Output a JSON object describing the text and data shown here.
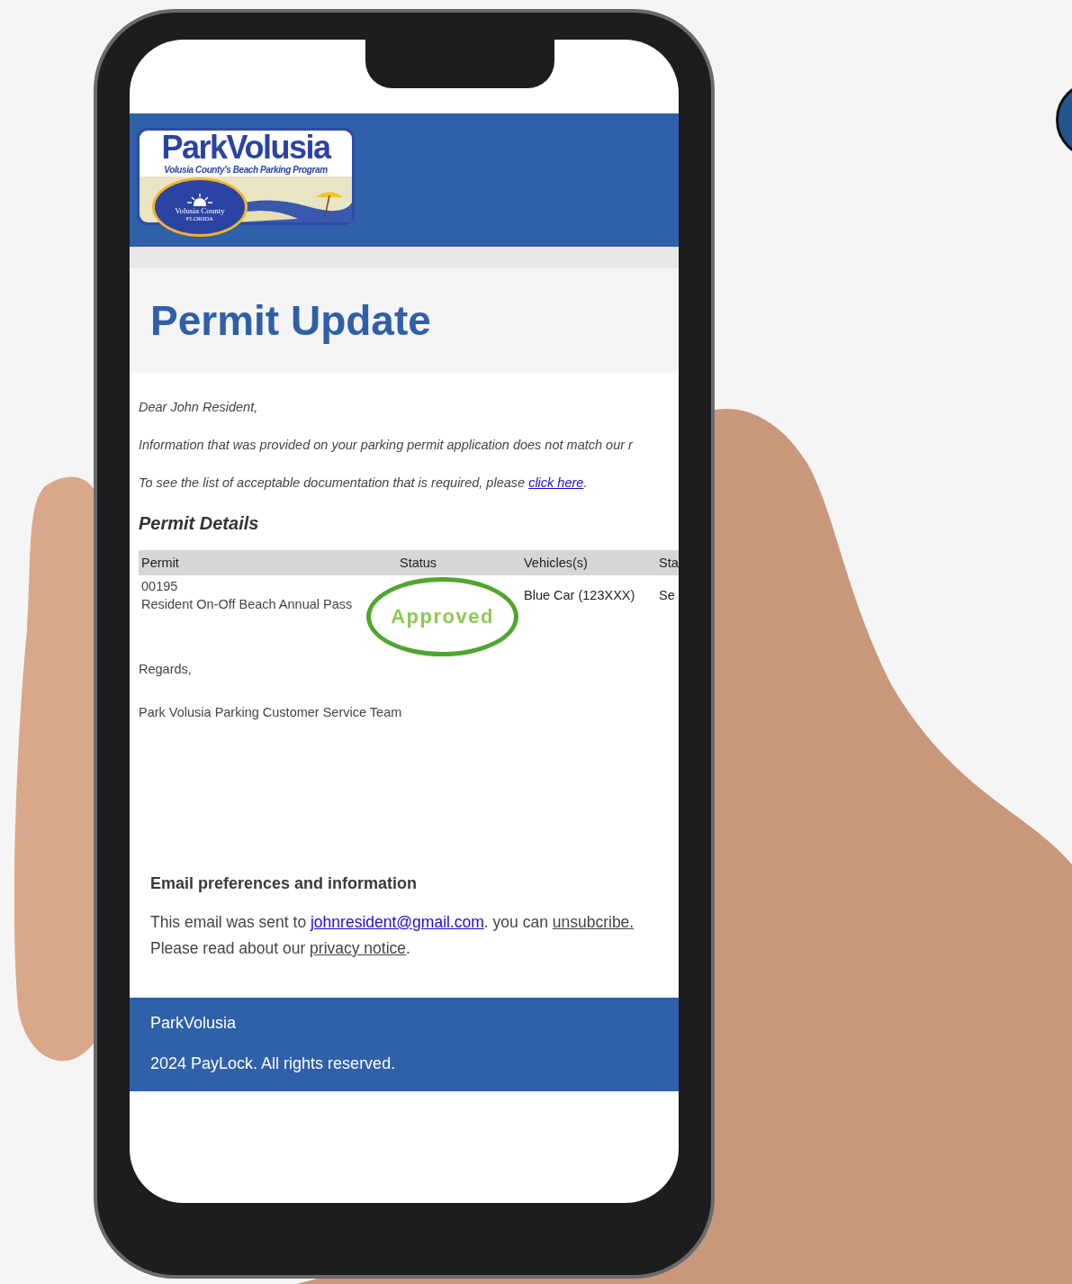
{
  "header": {
    "logo": {
      "title": "ParkVolusia",
      "tagline": "Volusia County's Beach Parking Program",
      "seal": "Volusia County",
      "seal_sub": "FLORIDA"
    }
  },
  "title": "Permit Update",
  "greeting": "Dear John Resident,",
  "paragraphs": [
    "Information that was provided on your parking permit application does not match our r"
  ],
  "docs_line": {
    "text": "To see the list of acceptable documentation that is required, please ",
    "link": "click here",
    "after": "."
  },
  "section_title": "Permit Details",
  "table": {
    "columns": [
      "Permit",
      "Status",
      "Vehicles(s)",
      "Sta"
    ],
    "rows": [
      {
        "permit_number": "00195",
        "permit_name": "Resident On-Off Beach Annual Pass",
        "status": "Approved",
        "vehicle": "Blue Car (123XXX)",
        "column_4": "Se",
        "highlighted": true
      }
    ]
  },
  "closing": "Regards,",
  "signature": "Park Volusia Parking Customer Service Team",
  "email_preferences": {
    "title": "Email preferences and information",
    "sent_before": "This email was sent to ",
    "email": "johnresident@gmail.com",
    "sent_middle": ". you can ",
    "unsubscribe": "unsubcribe.",
    "privacy_before": "Please read about our ",
    "privacy": "privacy notice",
    "privacy_after": "."
  },
  "footer": {
    "brand": "ParkVolusia",
    "copyright": "2024 PayLock. All rights reserved."
  }
}
